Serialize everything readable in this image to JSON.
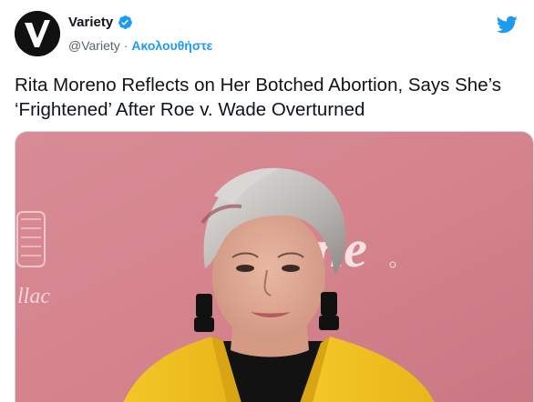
{
  "account": {
    "name": "Variety",
    "handle": "@Variety",
    "separator": "·",
    "follow_label": "Ακολουθήστε",
    "verified": true
  },
  "icons": {
    "avatar": "variety-v-logo",
    "verified": "verified-badge-icon",
    "platform": "twitter-bird-icon"
  },
  "tweet": {
    "text": "Rita Moreno Reflects on Her Botched Abortion, Says She’s ‘Frightened’ After Roe v. Wade Overturned"
  },
  "media": {
    "backdrop_text_1": "ne",
    "backdrop_text_2": "llac"
  },
  "colors": {
    "accent": "#1d9bf0",
    "backdrop": "#d98690",
    "jacket": "#f2c21d"
  }
}
